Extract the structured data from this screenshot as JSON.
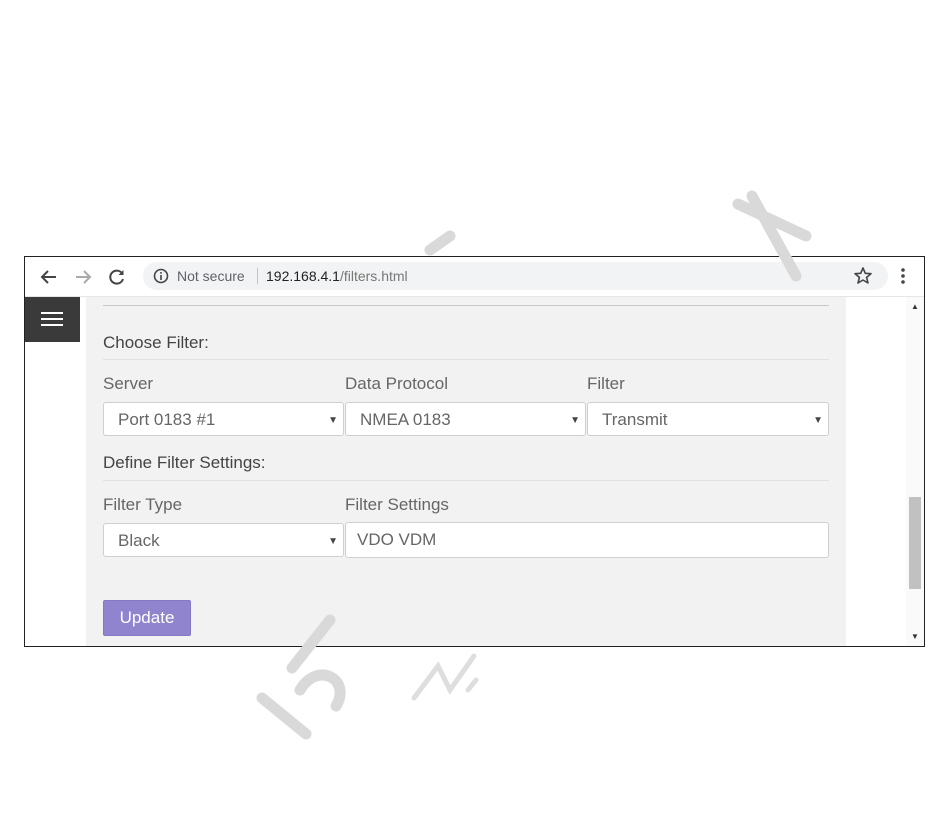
{
  "browser": {
    "security_text": "Not secure",
    "url_host": "192.168.4.1",
    "url_path": "/filters.html"
  },
  "page": {
    "choose_filter_title": "Choose Filter:",
    "server": {
      "label": "Server",
      "selected": "Port 0183 #1"
    },
    "data_protocol": {
      "label": "Data Protocol",
      "selected": "NMEA 0183"
    },
    "filter": {
      "label": "Filter",
      "selected": "Transmit"
    },
    "define_settings_title": "Define Filter Settings:",
    "filter_type": {
      "label": "Filter Type",
      "selected": "Black"
    },
    "filter_settings": {
      "label": "Filter Settings",
      "value": "VDO VDM"
    },
    "update_label": "Update"
  },
  "colors": {
    "accent": "#9184cf",
    "panel": "#f2f2f2",
    "menu": "#3a3a3a"
  },
  "icons": [
    "back-icon",
    "forward-icon",
    "reload-icon",
    "info-icon",
    "star-icon",
    "kebab-menu-icon",
    "hamburger-icon",
    "chevron-down-icon"
  ]
}
